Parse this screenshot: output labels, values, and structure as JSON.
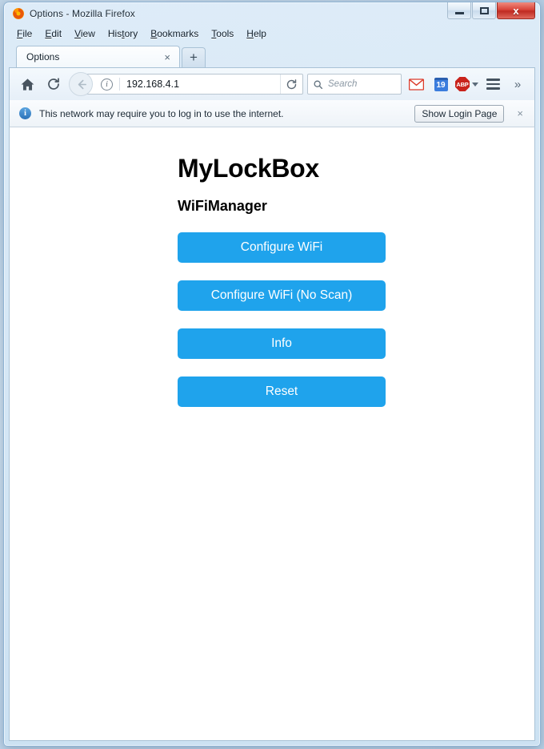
{
  "window": {
    "title": "Options - Mozilla Firefox",
    "logo_icon": "firefox-logo-icon",
    "minimize_label": "",
    "maximize_label": "",
    "close_label": "x"
  },
  "menubar": {
    "items": [
      {
        "label": "File",
        "accesskey": "F"
      },
      {
        "label": "Edit",
        "accesskey": "E"
      },
      {
        "label": "View",
        "accesskey": "V"
      },
      {
        "label": "History",
        "accesskey": "t"
      },
      {
        "label": "Bookmarks",
        "accesskey": "B"
      },
      {
        "label": "Tools",
        "accesskey": "T"
      },
      {
        "label": "Help",
        "accesskey": "H"
      }
    ]
  },
  "tabstrip": {
    "tabs": [
      {
        "label": "Options",
        "close_glyph": "×"
      }
    ],
    "newtab_glyph": "+"
  },
  "navbar": {
    "home_icon": "home-icon",
    "reload_icon": "reload-icon",
    "back_icon": "back-arrow-icon",
    "url": {
      "identity_icon": "info-icon",
      "identity_glyph": "i",
      "value": "192.168.4.1",
      "reload_icon": "reload-icon"
    },
    "search": {
      "icon": "search-icon",
      "placeholder": "Search",
      "value": ""
    },
    "extensions": [
      {
        "name": "gmail-icon",
        "label": "M"
      },
      {
        "name": "calendar-icon",
        "label": "19"
      },
      {
        "name": "adblock-plus-icon",
        "label": "ABP"
      }
    ],
    "menu_icon": "hamburger-menu-icon",
    "overflow_icon": "chevron-double-right-icon",
    "overflow_glyph": "»"
  },
  "notification": {
    "icon": "info-icon",
    "icon_glyph": "i",
    "message": "This network may require you to log in to use the internet.",
    "action_label": "Show Login Page",
    "close_glyph": "×"
  },
  "page": {
    "title": "MyLockBox",
    "subtitle": "WiFiManager",
    "buttons": [
      {
        "label": "Configure WiFi"
      },
      {
        "label": "Configure WiFi (No Scan)"
      },
      {
        "label": "Info"
      },
      {
        "label": "Reset"
      }
    ]
  },
  "colors": {
    "button_blue": "#1fa3ec",
    "close_red": "#c9231c",
    "frame_blue": "#a9c2d6"
  }
}
